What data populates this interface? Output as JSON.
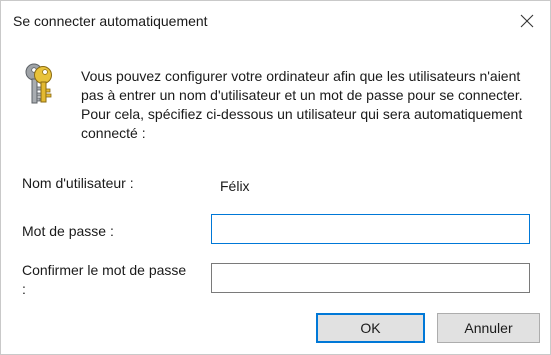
{
  "window": {
    "title": "Se connecter automatiquement",
    "close_icon": "close-icon"
  },
  "icon": "keys-icon",
  "description": "Vous pouvez configurer votre ordinateur afin que les utilisateurs n'aient pas à entrer un nom d'utilisateur et un mot de passe pour se connecter. Pour cela, spécifiez ci-dessous un utilisateur qui sera automatiquement connecté :",
  "fields": {
    "username": {
      "label": "Nom d'utilisateur :",
      "value": "Félix"
    },
    "password": {
      "label": "Mot de passe :",
      "value": ""
    },
    "confirm": {
      "label": "Confirmer le mot de passe :",
      "value": ""
    }
  },
  "buttons": {
    "ok": "OK",
    "cancel": "Annuler"
  },
  "colors": {
    "focus_accent": "#0078d7",
    "button_face": "#e1e1e1"
  }
}
